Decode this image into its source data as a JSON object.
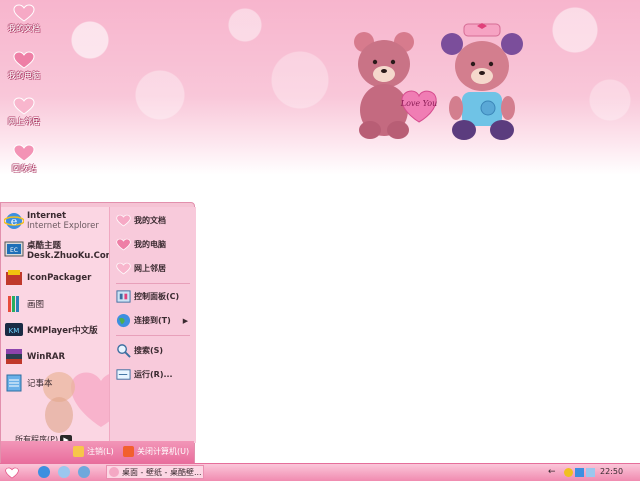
{
  "desktop": {
    "icons": [
      {
        "label": "我的文档",
        "icon": "heart-icon"
      },
      {
        "label": "我的电脑",
        "icon": "heart-icon"
      },
      {
        "label": "网上邻居",
        "icon": "heart-icon"
      },
      {
        "label": "回收站",
        "icon": "heart-icon"
      }
    ],
    "wallpaper_text": "Love You"
  },
  "start_menu": {
    "left_items": [
      {
        "title": "Internet",
        "subtitle": "Internet Explorer",
        "icon": "ie-icon"
      },
      {
        "title": "桌酷主题",
        "subtitle": "Desk.ZhuoKu.Com",
        "icon": "theme-icon"
      },
      {
        "title": "IconPackager",
        "subtitle": "",
        "icon": "iconpackager-icon"
      },
      {
        "title": "画图",
        "subtitle": "",
        "icon": "paint-icon"
      },
      {
        "title": "KMPlayer中文版",
        "subtitle": "",
        "icon": "kmplayer-icon"
      },
      {
        "title": "WinRAR",
        "subtitle": "",
        "icon": "winrar-icon"
      },
      {
        "title": "记事本",
        "subtitle": "",
        "icon": "notepad-icon"
      }
    ],
    "all_programs": "所有程序(P)",
    "right_items": [
      {
        "label": "我的文档",
        "icon": "heart-icon"
      },
      {
        "label": "我的电脑",
        "icon": "heart-icon"
      },
      {
        "label": "网上邻居",
        "icon": "heart-icon"
      },
      {
        "label": "控制面板(C)",
        "icon": "control-panel-icon"
      },
      {
        "label": "连接到(T)",
        "icon": "globe-icon"
      },
      {
        "label": "搜索(S)",
        "icon": "search-icon"
      },
      {
        "label": "运行(R)...",
        "icon": "run-icon"
      }
    ],
    "logoff": "注销(L)",
    "shutdown": "关闭计算机(U)"
  },
  "taskbar": {
    "task_label": "桌面 - 壁纸 - 桌酷壁...",
    "clock": "22:50"
  },
  "colors": {
    "accent": "#e96e9d",
    "menu_bg": "#fbd6e3",
    "heart": "#f48fb1"
  }
}
